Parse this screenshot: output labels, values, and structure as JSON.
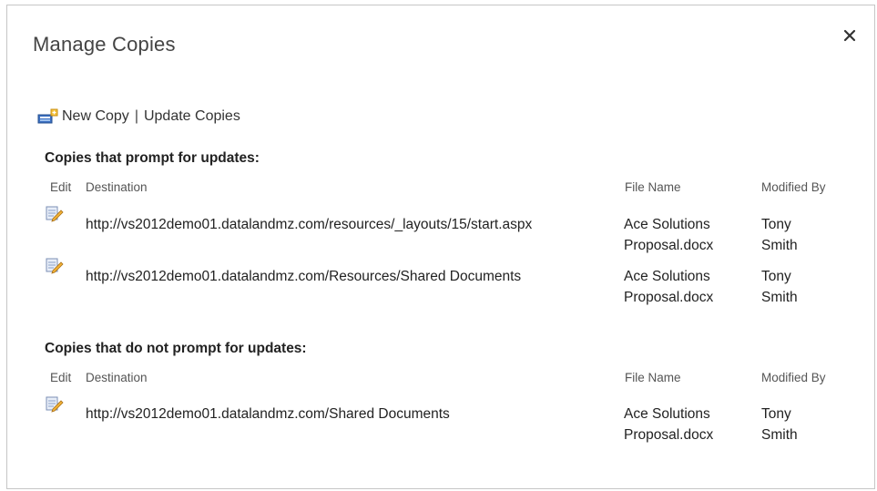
{
  "dialog": {
    "title": "Manage Copies",
    "close_label": "×"
  },
  "toolbar": {
    "new_copy": "New Copy",
    "separator": "|",
    "update_copies": "Update Copies"
  },
  "columns": {
    "edit": "Edit",
    "destination": "Destination",
    "file_name": "File Name",
    "modified_by": "Modified By"
  },
  "prompt_section": {
    "heading": "Copies that prompt for updates:",
    "rows": [
      {
        "destination": "http://vs2012demo01.datalandmz.com/resources/_layouts/15/start.aspx",
        "file_name_line1": "Ace Solutions",
        "file_name_line2": "Proposal.docx",
        "modified_by_line1": "Tony",
        "modified_by_line2": "Smith"
      },
      {
        "destination": "http://vs2012demo01.datalandmz.com/Resources/Shared Documents",
        "file_name_line1": "Ace Solutions",
        "file_name_line2": "Proposal.docx",
        "modified_by_line1": "Tony",
        "modified_by_line2": "Smith"
      }
    ]
  },
  "no_prompt_section": {
    "heading": "Copies that do not prompt for updates:",
    "rows": [
      {
        "destination": "http://vs2012demo01.datalandmz.com/Shared Documents",
        "file_name_line1": "Ace Solutions",
        "file_name_line2": "Proposal.docx",
        "modified_by_line1": "Tony",
        "modified_by_line2": "Smith"
      }
    ]
  },
  "icons": {
    "close": "close-icon",
    "new_copy": "new-copy-icon",
    "edit": "edit-icon"
  }
}
